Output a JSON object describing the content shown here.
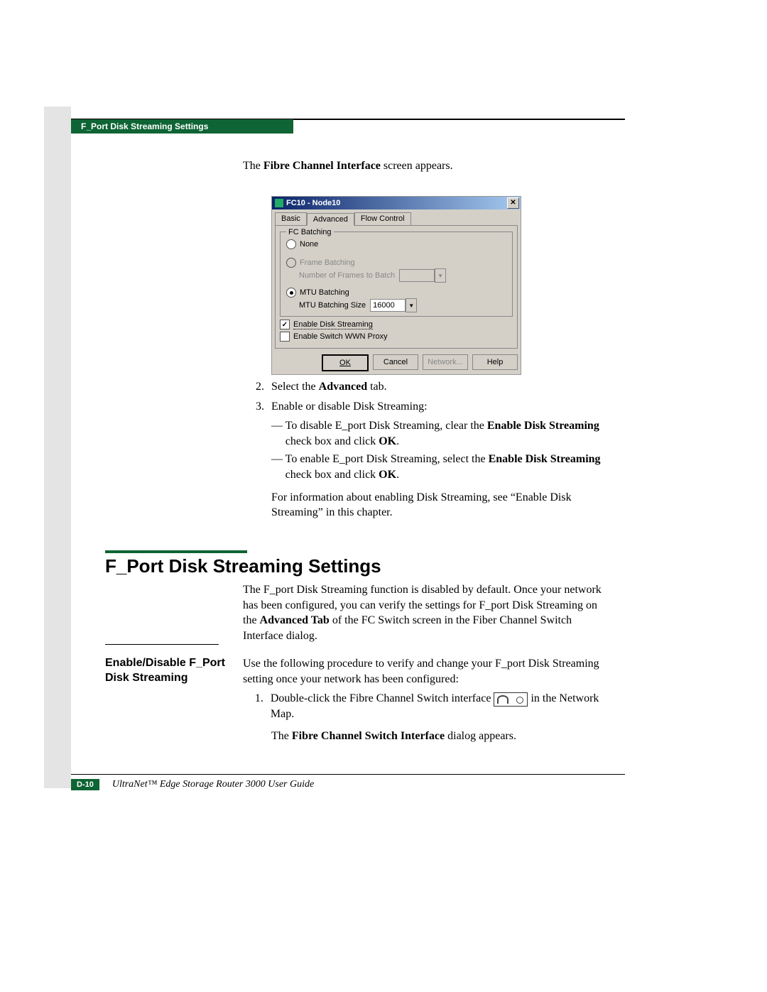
{
  "header": {
    "tab_label": "F_Port Disk Streaming Settings"
  },
  "intro": {
    "prefix": "The ",
    "bold": "Fibre Channel Interface",
    "suffix": " screen appears."
  },
  "dialog": {
    "title": "FC10 - Node10",
    "tabs": {
      "basic": "Basic",
      "advanced": "Advanced",
      "flow": "Flow Control"
    },
    "fieldset_label": "FC Batching",
    "radio_none": "None",
    "radio_frame": "Frame Batching",
    "frame_sub_label": "Number of Frames to Batch",
    "radio_mtu": "MTU Batching",
    "mtu_sub_label": "MTU Batching Size",
    "mtu_value": "16000",
    "cb_disk": "Enable Disk Streaming",
    "cb_disk_checked": "✓",
    "cb_wwn": "Enable Switch WWN Proxy",
    "buttons": {
      "ok": "OK",
      "cancel": "Cancel",
      "network": "Network...",
      "help": "Help"
    }
  },
  "steps": {
    "s2_pre": "Select the ",
    "s2_bold": "Advanced",
    "s2_post": " tab.",
    "s3": "Enable or disable Disk Streaming:",
    "d1_pre": "To disable E_port Disk Streaming, clear the ",
    "d1_bold": "Enable Disk Streaming",
    "d1_mid": " check box and click ",
    "d1_bold2": "OK",
    "d1_end": ".",
    "d2_pre": "To enable E_port Disk Streaming, select the ",
    "d2_bold": "Enable Disk Streaming",
    "d2_mid": " check box and click ",
    "d2_bold2": "OK",
    "d2_end": ".",
    "para": "For information about enabling Disk Streaming, see “Enable Disk Streaming” in this chapter."
  },
  "section": {
    "title": "F_Port Disk Streaming Settings",
    "body_pre": "The F_port Disk Streaming function is disabled by default. Once your network has been configured, you can verify the settings for F_port Disk Streaming on the ",
    "body_bold": "Advanced Tab",
    "body_post": " of the FC Switch screen in the Fiber Channel Switch Interface dialog."
  },
  "sub": {
    "heading": "Enable/Disable F_Port Disk Streaming",
    "lead": "Use the following procedure to verify and change your F_port Disk Streaming setting once your network has been configured:",
    "step1_pre": "Double-click the Fibre Channel Switch interface ",
    "step1_post": " in the Network Map.",
    "after_pre": "The ",
    "after_bold": "Fibre Channel Switch Interface",
    "after_post": " dialog appears."
  },
  "footer": {
    "page": "D-10",
    "title": "UltraNet™ Edge Storage Router 3000 User Guide"
  }
}
